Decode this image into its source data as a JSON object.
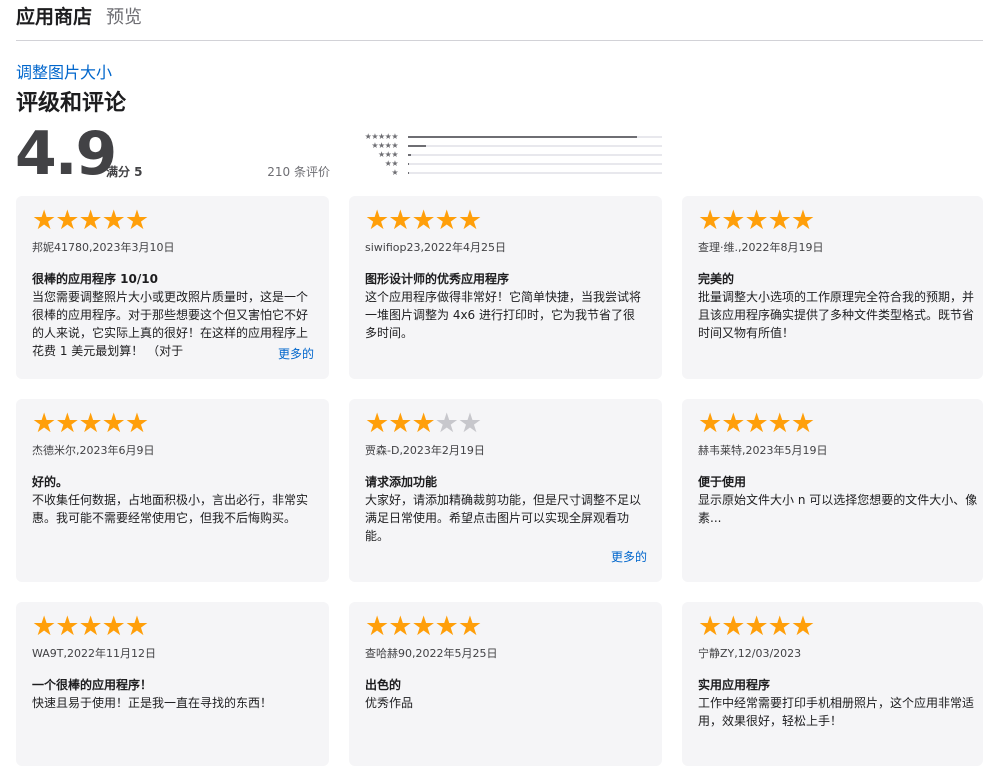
{
  "header": {
    "brand": "应用商店",
    "sub": "预览"
  },
  "app": {
    "name": "调整图片大小"
  },
  "ratings": {
    "title": "评级和评论",
    "average": "4.9",
    "out_of": "满分 5",
    "total": "210 条评价",
    "histogram": [
      {
        "stars": "★★★★★",
        "fraction": 0.9
      },
      {
        "stars": "★★★★",
        "fraction": 0.07
      },
      {
        "stars": "★★★",
        "fraction": 0.01
      },
      {
        "stars": "★★",
        "fraction": 0.005
      },
      {
        "stars": "★",
        "fraction": 0.005
      }
    ]
  },
  "reviews": [
    {
      "rating": 5,
      "author": "邦妮41780,2023年3月10日",
      "title": "很棒的应用程序 10/10",
      "body": "当您需要调整照片大小或更改照片质量时，这是一个很棒的应用程序。对于那些想要这个但又害怕它不好的人来说，它实际上真的很好！在这样的应用程序上花费 1 美元最划算！ （对于",
      "more": "更多的"
    },
    {
      "rating": 5,
      "author": "siwifiop23,2022年4月25日",
      "title": "图形设计师的优秀应用程序",
      "body": "这个应用程序做得非常好！它简单快捷，当我尝试将一堆图片调整为 4x6 进行打印时，它为我节省了很多时间。",
      "more": ""
    },
    {
      "rating": 5,
      "author": "查理·维.,2022年8月19日",
      "title": "完美的",
      "body": "批量调整大小选项的工作原理完全符合我的预期，并且该应用程序确实提供了多种文件类型格式。既节省时间又物有所值！",
      "more": ""
    },
    {
      "rating": 5,
      "author": "杰德米尔,2023年6月9日",
      "title": "好的。",
      "body": "不收集任何数据，占地面积极小，言出必行，非常实惠。我可能不需要经常使用它，但我不后悔购买。",
      "more": ""
    },
    {
      "rating": 3,
      "author": "贾森-D,2023年2月19日",
      "title": "请求添加功能",
      "body": "大家好，请添加精确裁剪功能，但是尺寸调整不足以满足日常使用。希望点击图片可以实现全屏观看功能。",
      "more": "更多的"
    },
    {
      "rating": 5,
      "author": "赫韦莱特,2023年5月19日",
      "title": "便于使用",
      "body": "显示原始文件大小 n 可以选择您想要的文件大小、像素...",
      "more": ""
    },
    {
      "rating": 5,
      "author": "WA9T,2022年11月12日",
      "title": "一个很棒的应用程序！",
      "body": "快速且易于使用！正是我一直在寻找的东西！",
      "more": ""
    },
    {
      "rating": 5,
      "author": "查哈赫90,2022年5月25日",
      "title": "出色的",
      "body": "优秀作品",
      "more": ""
    },
    {
      "rating": 5,
      "author": "宁静ZY,12/03/2023",
      "title": "实用应用程序",
      "body": "工作中经常需要打印手机相册照片，这个应用非常适用，效果很好，轻松上手！",
      "more": ""
    }
  ],
  "colors": {
    "star": "#ff9f0a",
    "star_empty": "#c7c7cc",
    "link": "#0066cc",
    "card_bg": "#f5f5f7"
  }
}
